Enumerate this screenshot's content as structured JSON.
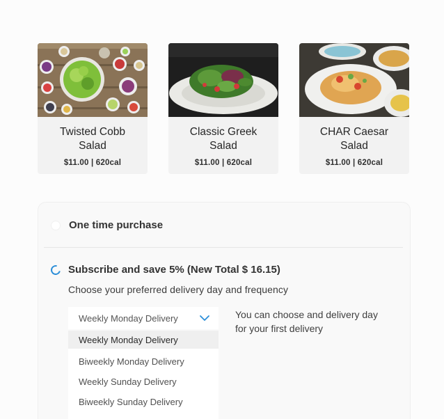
{
  "products": [
    {
      "name_line1": "Twisted Cobb",
      "name_line2": "Salad",
      "meta": "$11.00 | 620cal",
      "image": "cobb-salad-photo"
    },
    {
      "name_line1": "Classic Greek",
      "name_line2": "Salad",
      "meta": "$11.00 | 620cal",
      "image": "greek-salad-photo"
    },
    {
      "name_line1": "CHAR Caesar",
      "name_line2": "Salad",
      "meta": "$11.00 | 620cal",
      "image": "caesar-salad-photo"
    }
  ],
  "purchase": {
    "one_time_label": "One time purchase",
    "subscribe_label": "Subscribe and save 5% (New Total $ 16.15)",
    "subscribe_description": "Choose your preferred delivery day and frequency",
    "selected_value": "Weekly Monday Delivery",
    "hint_line1": "You can choose and delivery day",
    "hint_line2": "for your first delivery",
    "options": [
      "Weekly Monday Delivery",
      "Biweekly Monday Delivery",
      "Weekly Sunday Delivery",
      "Biweekly  Sunday Delivery"
    ]
  },
  "colors": {
    "accent": "#2c8ed8",
    "card_bg": "#f2f2f2",
    "panel_bg": "#f9f9f9"
  }
}
